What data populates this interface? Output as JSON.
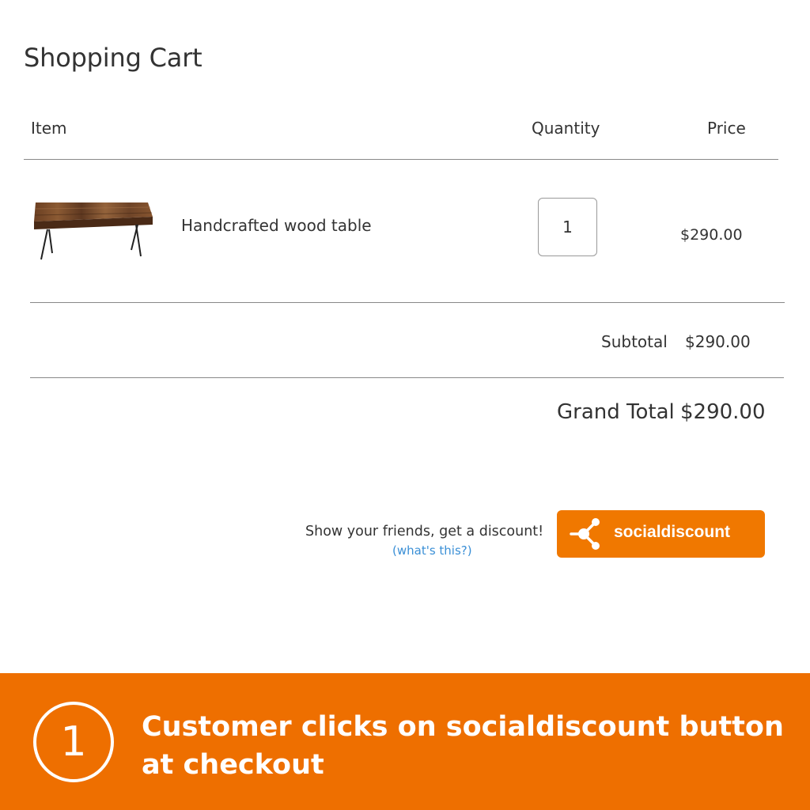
{
  "page": {
    "title": "Shopping Cart"
  },
  "table": {
    "headers": {
      "item": "Item",
      "quantity": "Quantity",
      "price": "Price"
    },
    "rows": [
      {
        "name": "Handcrafted wood table",
        "quantity": "1",
        "price": "$290.00"
      }
    ]
  },
  "totals": {
    "subtotal_label": "Subtotal",
    "subtotal_value": "$290.00",
    "grand_label": "Grand Total",
    "grand_value": "$290.00"
  },
  "promo": {
    "text": "Show your friends, get a discount!",
    "link": "(what's this?)",
    "button_label": "socialdiscount",
    "button_icon": "share-icon"
  },
  "banner": {
    "step_number": "1",
    "line1_prefix": "Customer clicks on ",
    "line1_bold": "socialdiscount",
    "line1_suffix": " button",
    "line2": "at checkout"
  },
  "colors": {
    "accent": "#f07800",
    "banner": "#ee6f00",
    "link": "#3a8fd6",
    "text": "#333333"
  }
}
